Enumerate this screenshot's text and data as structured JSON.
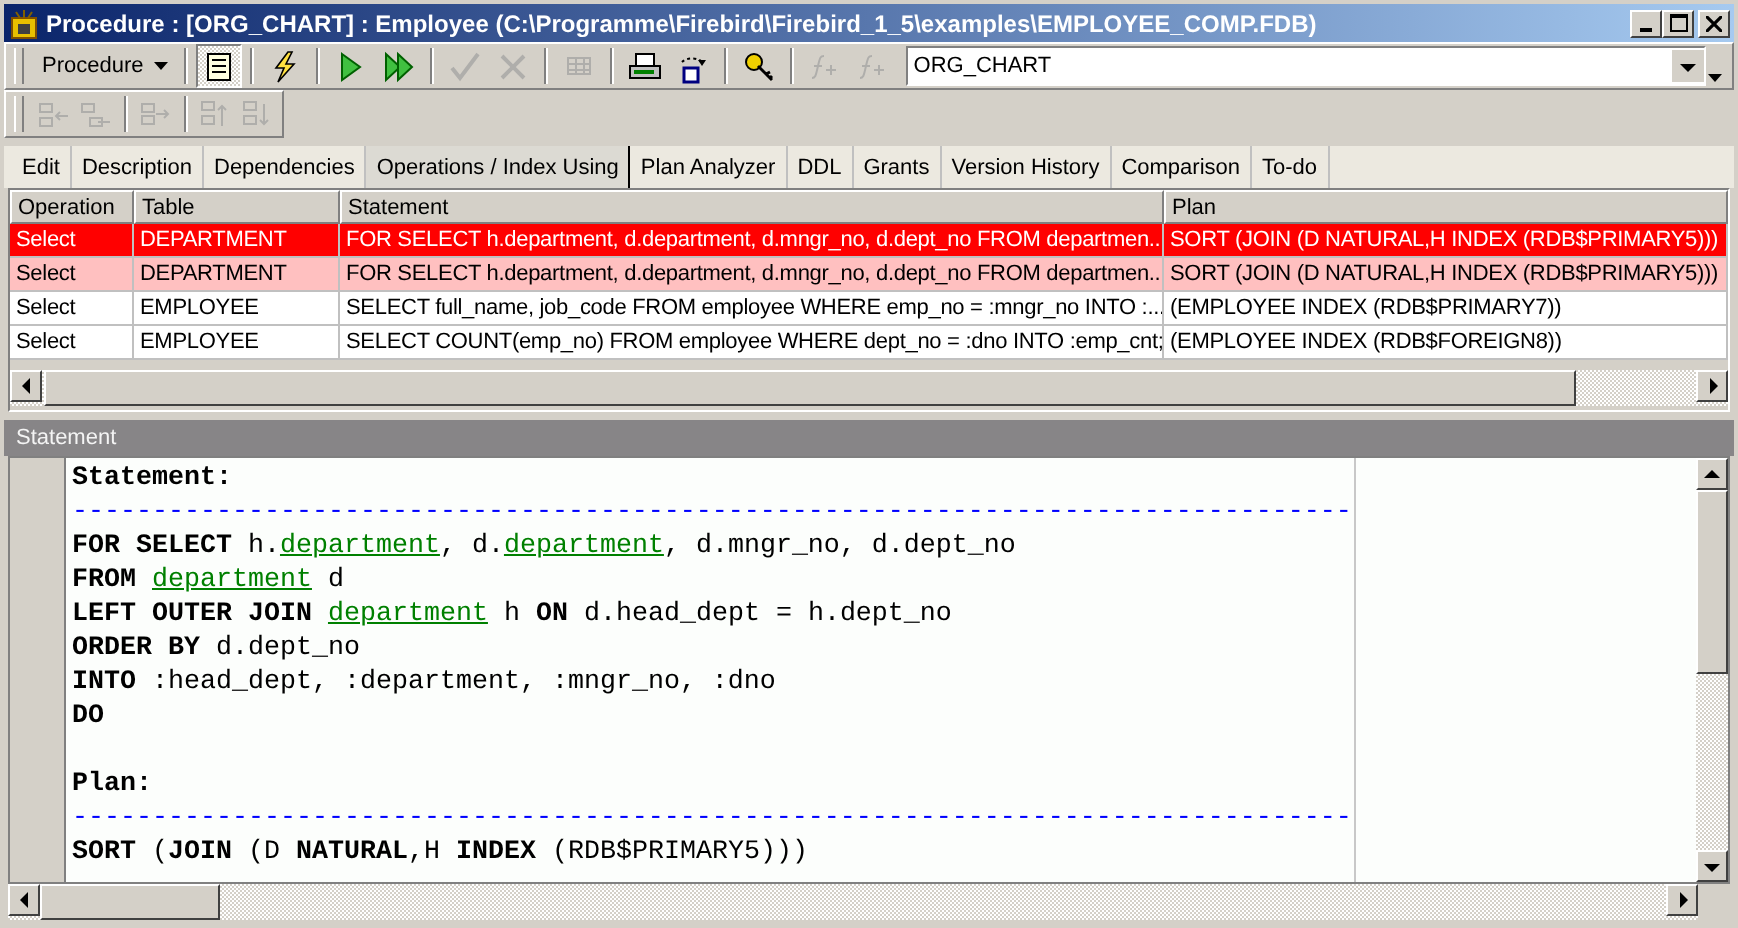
{
  "window": {
    "title": "Procedure : [ORG_CHART] : Employee (C:\\Programme\\Firebird\\Firebird_1_5\\examples\\EMPLOYEE_COMP.FDB)"
  },
  "toolbar": {
    "object_type": "Procedure",
    "object_name": "ORG_CHART",
    "buttons": [
      {
        "pressed": true,
        "disabled": false
      },
      {
        "pressed": false,
        "disabled": false
      },
      {
        "pressed": false,
        "disabled": false
      },
      {
        "pressed": false,
        "disabled": false
      },
      {
        "pressed": false,
        "disabled": true
      },
      {
        "pressed": false,
        "disabled": true
      },
      {
        "pressed": false,
        "disabled": true
      },
      {
        "pressed": false,
        "disabled": false
      },
      {
        "pressed": false,
        "disabled": false
      },
      {
        "pressed": false,
        "disabled": false
      },
      {
        "pressed": false,
        "disabled": true
      },
      {
        "pressed": false,
        "disabled": true
      }
    ]
  },
  "editor_toolbar": {
    "buttons": [
      {
        "disabled": true
      },
      {
        "disabled": true
      },
      {
        "disabled": true
      },
      {
        "disabled": true
      },
      {
        "disabled": true
      }
    ]
  },
  "tabs": [
    {
      "label": "Edit",
      "selected": false
    },
    {
      "label": "Description",
      "selected": false
    },
    {
      "label": "Dependencies",
      "selected": false
    },
    {
      "label": "Operations / Index Using",
      "selected": true
    },
    {
      "label": "Plan Analyzer",
      "selected": false
    },
    {
      "label": "DDL",
      "selected": false
    },
    {
      "label": "Grants",
      "selected": false
    },
    {
      "label": "Version History",
      "selected": false
    },
    {
      "label": "Comparison",
      "selected": false
    },
    {
      "label": "To-do",
      "selected": false
    }
  ],
  "table": {
    "columns": [
      "Operation",
      "Table",
      "Statement",
      "Plan"
    ],
    "rows": [
      {
        "cells": [
          "Select",
          "DEPARTMENT",
          "FOR SELECT h.department, d.department, d.mngr_no, d.dept_no FROM departmen...",
          "SORT (JOIN (D NATURAL,H INDEX (RDB$PRIMARY5)))"
        ],
        "selected": true,
        "highlighted": false
      },
      {
        "cells": [
          "Select",
          "DEPARTMENT",
          "FOR SELECT h.department, d.department, d.mngr_no, d.dept_no FROM departmen...",
          "SORT (JOIN (D NATURAL,H INDEX (RDB$PRIMARY5)))"
        ],
        "selected": false,
        "highlighted": true
      },
      {
        "cells": [
          "Select",
          "EMPLOYEE",
          "SELECT full_name, job_code FROM employee WHERE emp_no = :mngr_no INTO :...",
          "(EMPLOYEE INDEX (RDB$PRIMARY7))"
        ],
        "selected": false,
        "highlighted": false
      },
      {
        "cells": [
          "Select",
          "EMPLOYEE",
          "SELECT COUNT(emp_no) FROM employee WHERE dept_no = :dno INTO :emp_cnt;",
          "(EMPLOYEE INDEX (RDB$FOREIGN8))"
        ],
        "selected": false,
        "highlighted": false
      }
    ]
  },
  "statement_panel": {
    "title": "Statement",
    "lines": [
      {
        "kind": "code",
        "segments": [
          {
            "kind": "keyword",
            "text": "Statement:"
          }
        ]
      },
      {
        "kind": "separator",
        "text": "--------------------------------------------------------------------------------"
      },
      {
        "kind": "code",
        "segments": [
          {
            "kind": "keyword",
            "text": "FOR SELECT"
          },
          {
            "kind": "plain",
            "text": " h."
          },
          {
            "kind": "object",
            "text": "department"
          },
          {
            "kind": "plain",
            "text": ", d."
          },
          {
            "kind": "object",
            "text": "department"
          },
          {
            "kind": "plain",
            "text": ", d.mngr_no, d.dept_no"
          }
        ]
      },
      {
        "kind": "code",
        "segments": [
          {
            "kind": "keyword",
            "text": "FROM "
          },
          {
            "kind": "object",
            "text": "department"
          },
          {
            "kind": "plain",
            "text": " d"
          }
        ]
      },
      {
        "kind": "code",
        "segments": [
          {
            "kind": "keyword",
            "text": "LEFT OUTER JOIN "
          },
          {
            "kind": "object",
            "text": "department"
          },
          {
            "kind": "plain",
            "text": " h "
          },
          {
            "kind": "keyword",
            "text": "ON"
          },
          {
            "kind": "plain",
            "text": " d.head_dept = h.dept_no"
          }
        ]
      },
      {
        "kind": "code",
        "segments": [
          {
            "kind": "keyword",
            "text": "ORDER BY"
          },
          {
            "kind": "plain",
            "text": " d.dept_no"
          }
        ]
      },
      {
        "kind": "code",
        "segments": [
          {
            "kind": "keyword",
            "text": "INTO"
          },
          {
            "kind": "plain",
            "text": " :head_dept, :department, :mngr_no, :dno"
          }
        ]
      },
      {
        "kind": "code",
        "segments": [
          {
            "kind": "keyword",
            "text": "DO"
          }
        ]
      },
      {
        "kind": "blank"
      },
      {
        "kind": "code",
        "segments": [
          {
            "kind": "keyword",
            "text": "Plan:"
          }
        ]
      },
      {
        "kind": "separator",
        "text": "--------------------------------------------------------------------------------"
      },
      {
        "kind": "code",
        "segments": [
          {
            "kind": "keyword",
            "text": "SORT"
          },
          {
            "kind": "plain",
            "text": " ("
          },
          {
            "kind": "keyword",
            "text": "JOIN"
          },
          {
            "kind": "plain",
            "text": " (D "
          },
          {
            "kind": "keyword",
            "text": "NATURAL"
          },
          {
            "kind": "plain",
            "text": ",H "
          },
          {
            "kind": "keyword",
            "text": "INDEX"
          },
          {
            "kind": "plain",
            "text": " (RDB$PRIMARY5)))"
          }
        ]
      }
    ]
  }
}
